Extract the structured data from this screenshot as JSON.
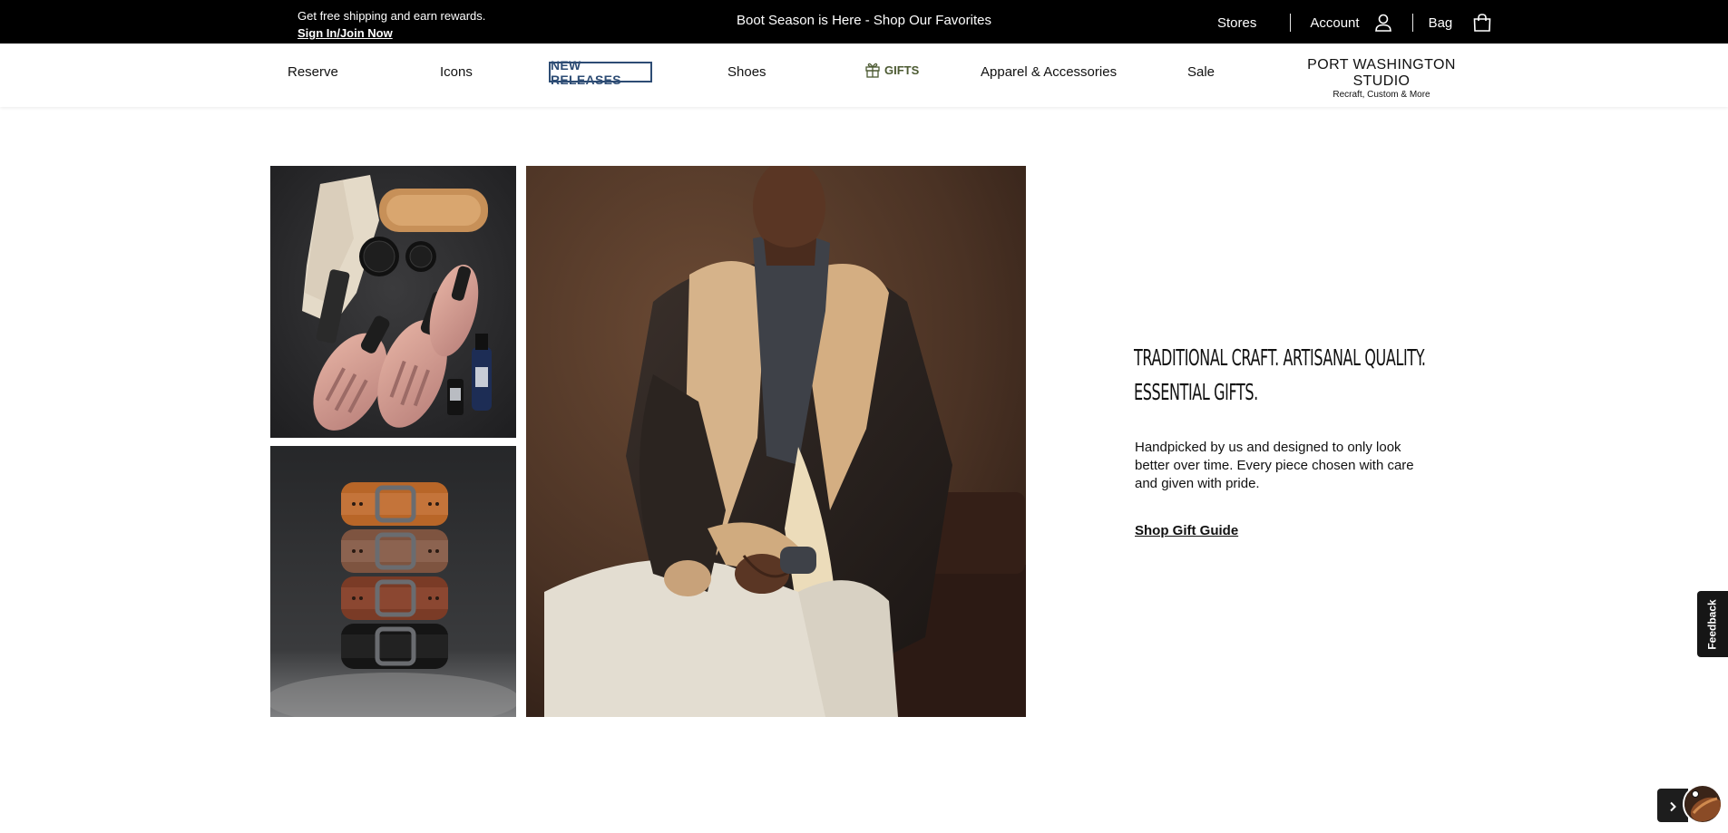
{
  "topbar": {
    "promo_line1": "Get free shipping and earn rewards.",
    "promo_link": "Sign In/Join Now",
    "announcement": "Boot Season is Here - Shop Our Favorites",
    "stores": "Stores",
    "account": "Account",
    "bag": "Bag",
    "icons": {
      "account": "user-icon",
      "bag": "shopping-bag-icon"
    }
  },
  "nav": {
    "items": [
      "Reserve",
      "Icons",
      "NEW RELEASES",
      "Shoes",
      "GIFTS",
      "Apparel & Accessories",
      "Sale"
    ],
    "gifts_icon": "gift-icon",
    "brand_title": "PORT WASHINGTON STUDIO",
    "brand_subtitle": "Recraft, Custom & More"
  },
  "hero": {
    "images": [
      "shoe-care-kit-image",
      "stacked-belts-image",
      "shearling-jacket-model-image"
    ],
    "headline_line1": "TRADITIONAL CRAFT. ARTISANAL QUALITY.",
    "headline_line2": "ESSENTIAL GIFTS.",
    "description": "Handpicked by us and designed to only look better over time. Every piece chosen with care and given with pride.",
    "cta": "Shop Gift Guide"
  },
  "widgets": {
    "feedback": "Feedback",
    "chevron_icon": "chevron-right-icon",
    "chat_icon": "chat-avatar-icon"
  },
  "colors": {
    "topbar_bg": "#000000",
    "new_releases_accent": "#2d4c74",
    "gifts_accent": "#4c5a32"
  }
}
